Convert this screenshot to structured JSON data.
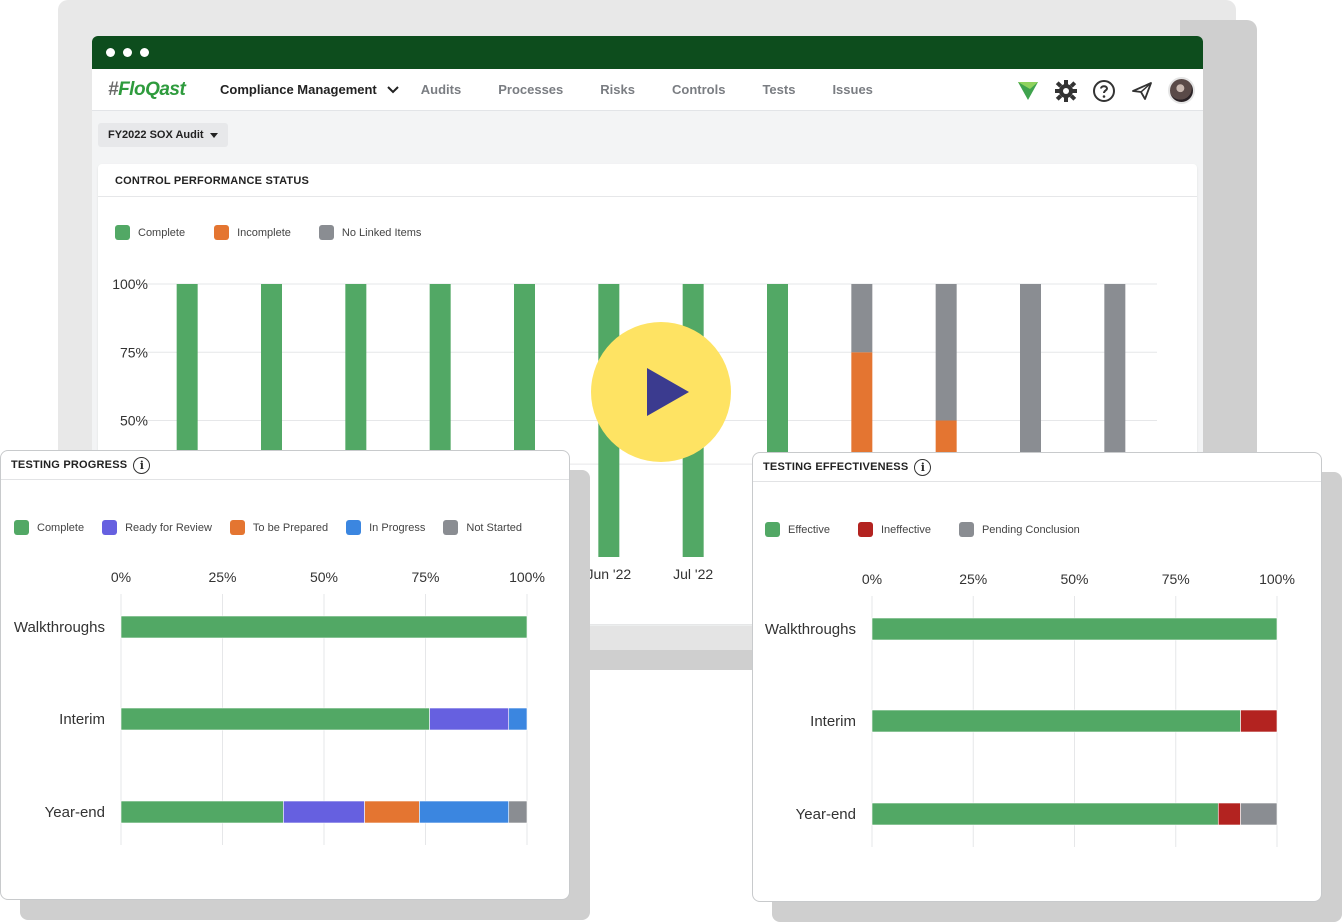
{
  "app": {
    "logo_hash": "#",
    "logo_text": "FloQast",
    "module": "Compliance Management",
    "nav": [
      "Audits",
      "Processes",
      "Risks",
      "Controls",
      "Tests",
      "Issues"
    ],
    "audit_selector": "FY2022 SOX Audit",
    "icons": [
      "floqast-flag-icon",
      "gear-icon",
      "help-icon",
      "send-icon",
      "avatar"
    ]
  },
  "colors": {
    "green": "#52a865",
    "orange": "#e47531",
    "gray": "#8a8d92",
    "purple": "#6660e0",
    "blue": "#3b86e0",
    "red": "#b32320",
    "dark_green": "#0d4d1d",
    "play": "#fee363"
  },
  "performance": {
    "title": "CONTROL PERFORMANCE STATUS",
    "legend": [
      "Complete",
      "Incomplete",
      "No Linked Items"
    ],
    "chart_data": {
      "type": "bar",
      "stacked": true,
      "yticks": [
        "100%",
        "75%",
        "50%"
      ],
      "ylim": [
        0,
        100
      ],
      "visible_x_labels": [
        {
          "index": 5,
          "label": "Jun '22"
        },
        {
          "index": 6,
          "label": "Jul '22"
        }
      ],
      "series": [
        {
          "name": "Complete",
          "values": [
            100,
            100,
            100,
            100,
            100,
            100,
            100,
            100,
            0,
            0,
            0,
            0
          ]
        },
        {
          "name": "Incomplete",
          "values": [
            0,
            0,
            0,
            0,
            0,
            0,
            0,
            0,
            75,
            50,
            0,
            0
          ]
        },
        {
          "name": "No Linked Items",
          "values": [
            0,
            0,
            0,
            0,
            0,
            0,
            0,
            0,
            25,
            50,
            100,
            100
          ]
        }
      ]
    }
  },
  "progress": {
    "title": "TESTING PROGRESS",
    "legend": [
      "Complete",
      "Ready for Review",
      "To be Prepared",
      "In Progress",
      "Not Started"
    ],
    "chart_data": {
      "type": "bar",
      "orientation": "horizontal",
      "stacked": true,
      "xticks": [
        "0%",
        "25%",
        "50%",
        "75%",
        "100%"
      ],
      "categories": [
        "Walkthroughs",
        "Interim",
        "Year-end"
      ],
      "series": [
        {
          "name": "Complete",
          "values": [
            100,
            76,
            40
          ]
        },
        {
          "name": "Ready for Review",
          "values": [
            0,
            19.5,
            20
          ]
        },
        {
          "name": "To be Prepared",
          "values": [
            0,
            0,
            13.5
          ]
        },
        {
          "name": "In Progress",
          "values": [
            0,
            4.5,
            22
          ]
        },
        {
          "name": "Not Started",
          "values": [
            0,
            0,
            4.5
          ]
        }
      ]
    }
  },
  "effectiveness": {
    "title": "TESTING EFFECTIVENESS",
    "legend": [
      "Effective",
      "Ineffective",
      "Pending Conclusion"
    ],
    "chart_data": {
      "type": "bar",
      "orientation": "horizontal",
      "stacked": true,
      "xticks": [
        "0%",
        "25%",
        "50%",
        "75%",
        "100%"
      ],
      "categories": [
        "Walkthroughs",
        "Interim",
        "Year-end"
      ],
      "series": [
        {
          "name": "Effective",
          "values": [
            100,
            91,
            85.5
          ]
        },
        {
          "name": "Ineffective",
          "values": [
            0,
            9,
            5.5
          ]
        },
        {
          "name": "Pending Conclusion",
          "values": [
            0,
            0,
            9
          ]
        }
      ]
    }
  }
}
